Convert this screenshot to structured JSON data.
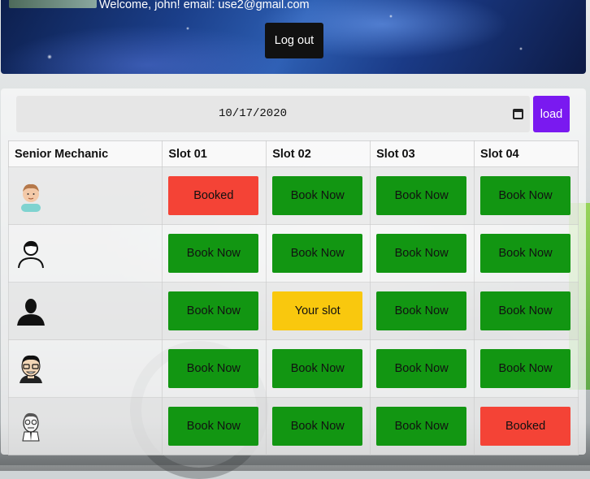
{
  "header": {
    "welcome_text": "Welcome, john! email: use2@gmail.com",
    "logout_label": "Log out"
  },
  "date_picker": {
    "value": "10/17/2020",
    "load_label": "load"
  },
  "table": {
    "headers": [
      "Senior Mechanic",
      "Slot 01",
      "Slot 02",
      "Slot 03",
      "Slot 04"
    ],
    "rows": [
      {
        "avatar": "man-face-icon",
        "slots": [
          "Booked",
          "Book Now",
          "Book Now",
          "Book Now"
        ]
      },
      {
        "avatar": "person-outline-icon",
        "slots": [
          "Book Now",
          "Book Now",
          "Book Now",
          "Book Now"
        ]
      },
      {
        "avatar": "person-silhouette-icon",
        "slots": [
          "Book Now",
          "Your slot",
          "Book Now",
          "Book Now"
        ]
      },
      {
        "avatar": "glasses-man-icon",
        "slots": [
          "Book Now",
          "Book Now",
          "Book Now",
          "Book Now"
        ]
      },
      {
        "avatar": "sketch-man-icon",
        "slots": [
          "Book Now",
          "Book Now",
          "Book Now",
          "Booked"
        ]
      }
    ]
  },
  "colors": {
    "available": "#129612",
    "booked": "#f44336",
    "your_slot": "#f9c80e",
    "load_button": "#7a19f0"
  }
}
